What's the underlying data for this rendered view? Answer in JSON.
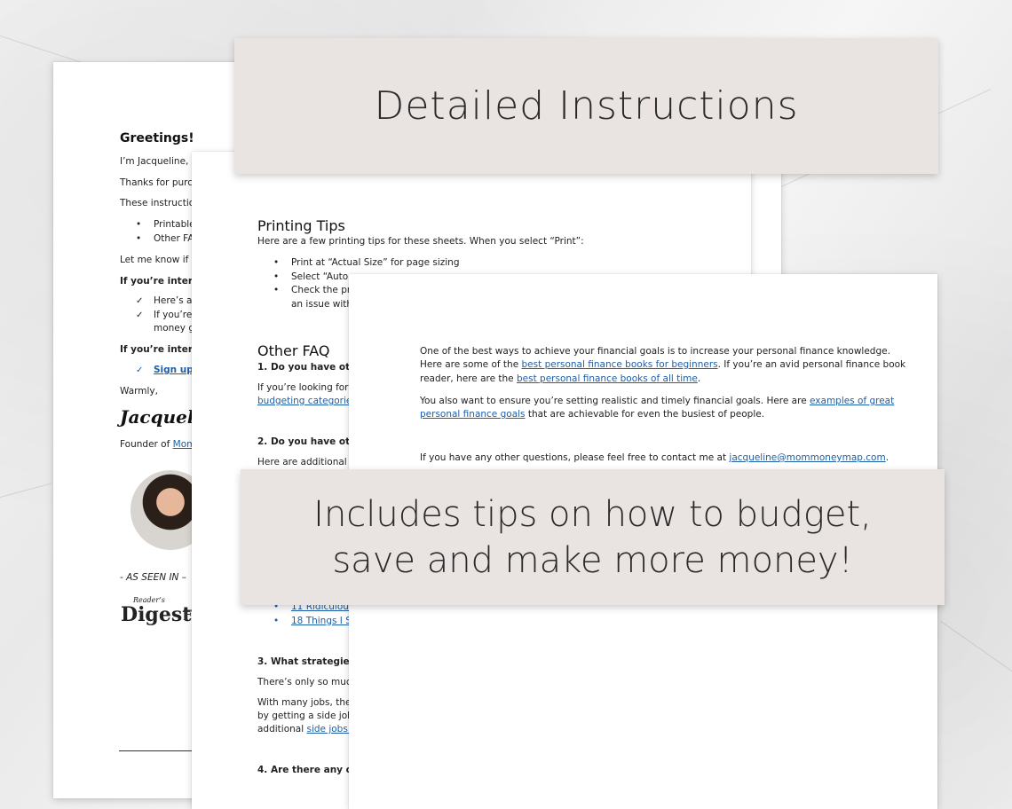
{
  "banner_top": "Detailed Instructions",
  "banner_bottom": "Includes tips on how to budget, save and make more money!",
  "sheet1": {
    "heading": "Greetings!",
    "line1": "I’m Jacqueline, th",
    "line2": "Thanks for purcha",
    "line3": "These instruction",
    "bullet1": "Printable",
    "bullet2": "Other FAQ",
    "line4": "Let me know if yo",
    "interested1": "If you’re intereste",
    "check1": "Here’s a s",
    "check2a": "If you’re l",
    "check2b": "money go",
    "interested2": "If you’re intereste",
    "signup": "Sign up to",
    "warmly": "Warmly,",
    "signature": "Jacqueline",
    "founder_prefix": "Founder of ",
    "founder_link": "MomM",
    "as_seen_in": "- AS SEEN IN –",
    "logo1_small": "Reader’s",
    "logo1": "Digest",
    "logo2": "F"
  },
  "sheet2": {
    "printing_title": "Printing Tips",
    "printing_intro": "Here are a few printing tips for these sheets. When you select “Print”:",
    "tip1": "Print at “Actual Size” for page sizing",
    "tip2": "Select “Auto p",
    "tip3": "Check the prev",
    "tip3b": "an issue with a",
    "faq_title": "Other FAQ",
    "q1": "1. Do you have other t",
    "q1_text": "If you’re looking for m",
    "q1_link": "budgeting categories a",
    "q2": "2. Do you have other b",
    "q2_text": "Here are additional res",
    "link_a": "11 Ridiculousl",
    "link_b": "18 Things I Sto",
    "q3": "3. What strategies do",
    "q3_text1": "There’s only so much m",
    "q3_text2": "With many jobs, there",
    "q3_text3": "by getting a side job. H",
    "q3_text4_prefix": "additional ",
    "q3_link": "side jobs to",
    "q4": "4. Are there any other"
  },
  "sheet3": {
    "p1_l1": "One of the best ways to achieve your financial goals is to increase your personal finance knowledge.",
    "p1_l2_prefix": "Here are some of the ",
    "p1_l2_link": "best personal finance books for beginners",
    "p1_l2_suffix": ". If you’re an avid personal finance book",
    "p1_l3_prefix": "reader, here are the ",
    "p1_l3_link": "best personal finance books of all time",
    "p1_l3_suffix": ".",
    "p2_l1_prefix": "You also want to ensure you’re setting realistic and timely financial goals. Here are ",
    "p2_l1_link": "examples of great",
    "p2_l2_link": "personal finance goals",
    "p2_l2_suffix": " that are achievable for even the busiest of people.",
    "p3_prefix": "If you have any other questions, please feel free to contact me at ",
    "p3_link": "jacqueline@mommoneymap.com",
    "p3_suffix": "."
  }
}
